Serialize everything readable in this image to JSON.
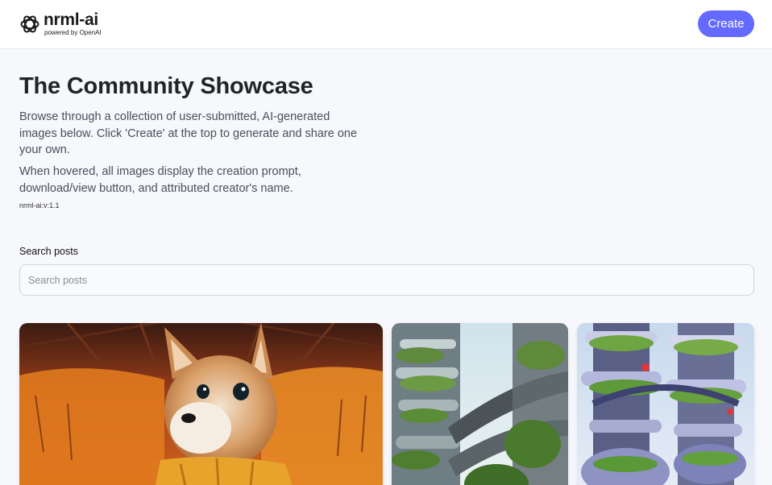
{
  "header": {
    "logo_title": "nrml-ai",
    "logo_subtitle": "powered by OpenAI",
    "create_label": "Create"
  },
  "main": {
    "title": "The Community Showcase",
    "description_1": "Browse through a collection of user-submitted, AI-generated images below. Click 'Create' at the top to generate and share one your own.",
    "description_2": "When hovered, all images display the creation prompt, download/view button, and attributed creator's name.",
    "version": "nrml-ai:v:1.1",
    "search_label": "Search posts",
    "search_placeholder": "Search posts",
    "search_value": ""
  },
  "gallery": [
    {
      "subject": "shiba dog in an orange spacesuit"
    },
    {
      "subject": "futuristic city with greenery and curved walkways"
    },
    {
      "subject": "futuristic towers covered in plants"
    }
  ],
  "colors": {
    "accent": "#6469ff",
    "background": "#f7f8fc",
    "header_bg": "#ffffff"
  },
  "icons": {
    "logo": "openai-logo-icon"
  }
}
